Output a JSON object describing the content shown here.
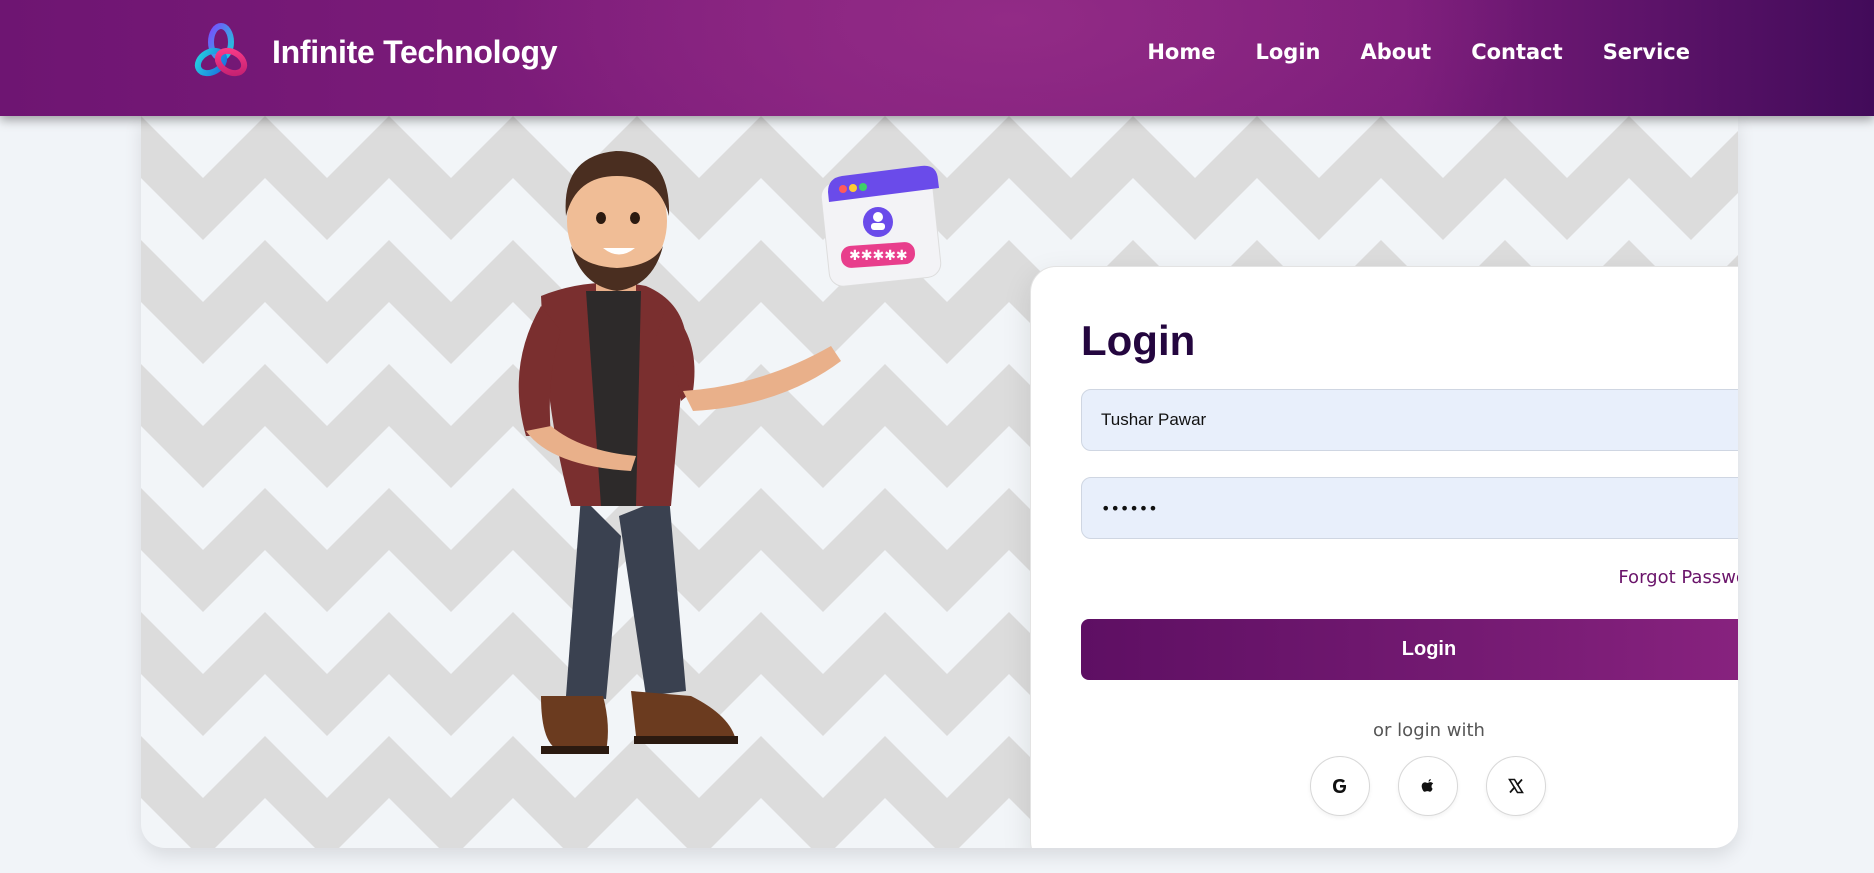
{
  "header": {
    "brand": "Infinite Technology",
    "logo_icon": "triple-ring-logo-icon",
    "nav": [
      "Home",
      "Login",
      "About",
      "Contact",
      "Service"
    ]
  },
  "login_card": {
    "title": "Login",
    "username_value": "Tushar Pawar",
    "password_mask": "••••••",
    "forgot_link": "Forgot Password?",
    "submit_label": "Login",
    "or_text": "or login with",
    "social_providers": [
      "google-icon",
      "apple-icon",
      "x-icon"
    ]
  },
  "colors": {
    "header_purple": "#7a1c7a",
    "title": "#24063f",
    "button_start": "#5e0f63",
    "button_end": "#8a2380",
    "input_bg": "#e8effb"
  }
}
